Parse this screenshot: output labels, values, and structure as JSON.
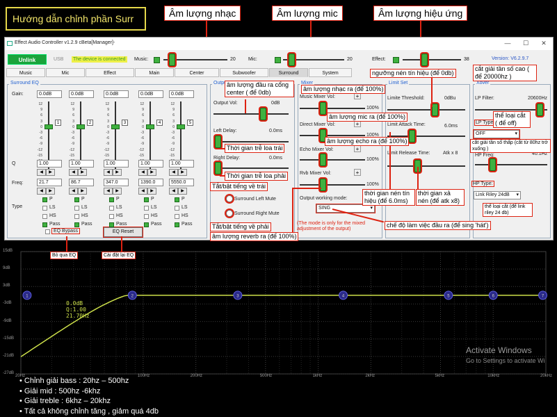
{
  "banner": {
    "title": "Hướng dẫn chỉnh phần Surr",
    "label_music_volume": "Âm lượng nhạc",
    "label_mic_volume": "Âm lượng mic",
    "label_effect_volume": "Âm lượng hiệu ứng"
  },
  "window": {
    "title": "Effect Audio Controller v1.2.9 cBeta[Manager]-",
    "unlink_label": "Unlink",
    "usb_label": "USB",
    "connection_status": "The device is connected",
    "version": "Version: V6.2.9.7"
  },
  "top_sliders": {
    "music": {
      "label": "Music:",
      "value": "20",
      "level": 0.1
    },
    "mic": {
      "label": "Mic:",
      "value": "20",
      "level": 0.1
    },
    "effect": {
      "label": "Effect:",
      "value": "38",
      "level": 0.36
    }
  },
  "tabs": [
    "Music",
    "Mic",
    "Effect",
    "Main",
    "Center",
    "Subwoofer",
    "Surround",
    "System"
  ],
  "active_tab": "Surround",
  "eq": {
    "group_label": "Surround EQ",
    "gain_label": "Gain:",
    "q_label": "Q",
    "freq_label": "Freq:",
    "type_label": "Type",
    "scale": [
      "12",
      "9",
      "6",
      "3",
      "0",
      "-3",
      "-6",
      "-9",
      "-12",
      "-15",
      "-18",
      "-21",
      "-24"
    ],
    "bands": [
      {
        "num": "1",
        "gain": "0.0dB",
        "q": "1.00",
        "freq": "21.7"
      },
      {
        "num": "2",
        "gain": "0.0dB",
        "q": "1.00",
        "freq": "86.7"
      },
      {
        "num": "3",
        "gain": "0.0dB",
        "q": "1.00",
        "freq": "347.0"
      },
      {
        "num": "4",
        "gain": "0.0dB",
        "q": "1.00",
        "freq": "1390.0"
      },
      {
        "num": "5",
        "gain": "0.0dB",
        "q": "1.00",
        "freq": "5550.0"
      }
    ],
    "type_options": [
      "P",
      "LS",
      "HS",
      "Pass"
    ],
    "bypass_label": "EQ Bypass",
    "reset_label": "EQ Reset"
  },
  "output": {
    "group_label": "Output",
    "output_vol_label": "Output Vol:",
    "output_vol_value": "0dB",
    "left_delay_label": "Left Delay:",
    "left_delay_value": "0.0ms",
    "right_delay_label": "Right Delay:",
    "right_delay_value": "0.0ms",
    "left_mute_label": "Surround Left Mute",
    "right_mute_label": "Surround Right Mute"
  },
  "mixer": {
    "group_label": "Mixer",
    "music_mixer_label": "Music Mixer Vol:",
    "music_mixer_value": "100%",
    "direct_mixer_label": "Direct Mixer Vol:",
    "direct_mixer_value": "100%",
    "echo_mixer_label": "Echo Mixer Vol:",
    "echo_mixer_value": "100%",
    "rvb_mixer_label": "Rvb Mixer Vol:",
    "rvb_mixer_value": "100%",
    "working_mode_label": "Output working mode:",
    "working_mode_value": "SING",
    "note": "(The mode is only for the mixed adjustment of the output)"
  },
  "limiter": {
    "group_label": "Limit Set",
    "threshold_label": "Limite Threshold:",
    "threshold_value": "0dBu",
    "attack_label": "Limit Attack Time:",
    "attack_value": "6.0ms",
    "release_label": "Limit Release Time:",
    "release_value": "Atk x 8"
  },
  "xover": {
    "group_label": "Xover",
    "lp_filter_label": "LP Filter:",
    "lp_filter_value": "20600Hz",
    "lp_type_label": "LP Type:",
    "lp_type_value": "OFF",
    "hp_freq_label": "HP Freq:",
    "hp_freq_value": "40.1Hz",
    "hp_type_label": "HP Type:",
    "hp_type_value": "Link Riley 24dB"
  },
  "annotations": {
    "center_out": "âm lượng đầu ra cổng center ( để 0db)",
    "left_delay": "Thời gian trễ loa trái",
    "right_delay": "Thời gian trễ loa phải",
    "left_mute": "Tắt/bật tiếng về trái",
    "right_mute": "Tắt/bật tiếng về phải",
    "reverb_out": "âm lượng reverb ra (để 100%)",
    "music_out": "âm lượng nhạc ra (để 100%)",
    "mic_out": "âm lượng mic ra (để 100%)",
    "echo_out": "âm lượng echo ra (để 100%)",
    "compress_threshold": "ngưỡng nén tín hiệu (để 0db)",
    "compress_time": "thời gian nén tín hiệu (để 6.0ms)",
    "release_time": "thời gian xả nén (để atk x8)",
    "output_mode": "chế độ làm việc đầu ra (để sing 'hát')",
    "hp_cut": "cắt giải tần số cao ( để 20000hz )",
    "lp_type": "thể loại cắt ( để off)",
    "low_cut": "cắt giải tần số thấp (cắt từ 80hz trở xuống )",
    "hp_type": "thể loại cắt (để link riley 24 db)",
    "eq_bypass": "Bỏ qua EQ",
    "eq_reset": "Cài đặt lại EQ"
  },
  "plot": {
    "y_ticks": [
      "15dB",
      "9dB",
      "3dB",
      "-3dB",
      "-9dB",
      "-15dB",
      "-21dB",
      "-27dB"
    ],
    "x_ticks": [
      "20Hz",
      "100Hz",
      "200Hz",
      "500Hz",
      "1kHz",
      "2kHz",
      "5kHz",
      "10kHz",
      "20kHz"
    ],
    "band_markers": [
      "1",
      "2",
      "3",
      "4",
      "5",
      "6",
      "7"
    ],
    "readout_gain": "0.0dB",
    "readout_q": "Q:1.00",
    "readout_freq": "21.70Hz",
    "curve_color": "#cde04a"
  },
  "notes": [
    "Chỉnh giải bass : 20hz – 500hz",
    "Giải mid : 500hz -6khz",
    "Giải treble : 6khz – 20khz",
    "Tất cả không chỉnh tăng , giảm quá 4db"
  ],
  "watermark": {
    "line1": "Activate Windows",
    "line2": "Go to Settings to activate Wi"
  }
}
